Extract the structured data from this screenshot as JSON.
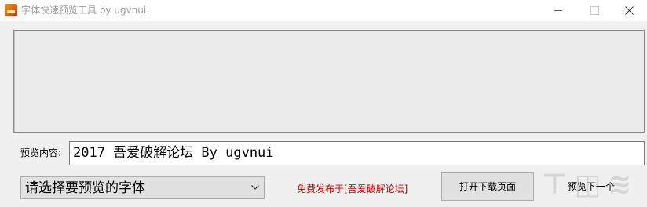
{
  "window": {
    "title": "字体快速预览工具 by ugvnui",
    "icon": "app-icon"
  },
  "form": {
    "content_label": "预览内容:",
    "content_value": "2017 吾爱破解论坛 By ugvnui",
    "font_select_value": "请选择要预览的字体",
    "notice": "免费发布于[吾爱破解论坛]",
    "open_download_label": "打开下载页面",
    "next_label": "预览下一个"
  },
  "colors": {
    "notice": "#c00000",
    "preview_bg": "#ececec"
  }
}
